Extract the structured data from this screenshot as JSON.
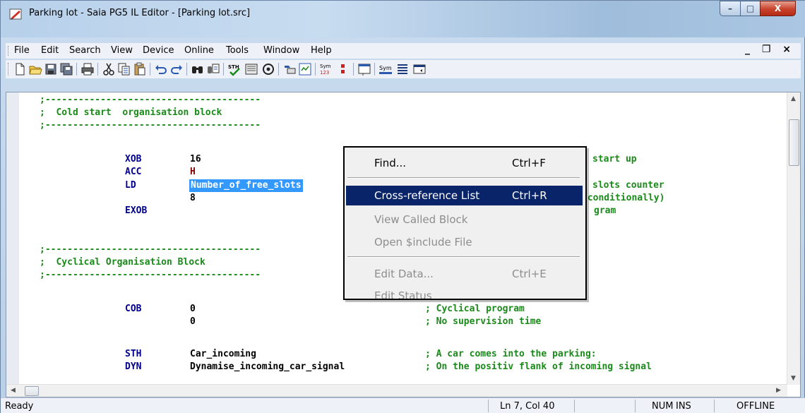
{
  "window": {
    "title": "Parking lot - Saia PG5 IL Editor - [Parking lot.src]",
    "minimize_glyph": "–",
    "maximize_glyph": "□",
    "close_glyph": "X",
    "mdi_controls": "_ ❐ ×"
  },
  "menu": {
    "items": [
      "File",
      "Edit",
      "Search",
      "View",
      "Device",
      "Online",
      "Tools",
      "Window",
      "Help"
    ]
  },
  "toolbar": {
    "icons": [
      "new-file-icon",
      "open-folder-icon",
      "save-icon",
      "save-all-icon",
      "print-icon",
      "cut-icon",
      "copy-icon",
      "paste-icon",
      "undo-icon",
      "redo-icon",
      "find-icon",
      "replace-icon",
      "spell-check-icon",
      "build-icon",
      "online-icon",
      "device-icon",
      "symbol-editor-icon",
      "sym-123-icon",
      "breakpoint-icon",
      "watch-window-icon",
      "sym-icon",
      "list-icon",
      "dock-icon"
    ],
    "sym_label": "Sym",
    "sym123_label": "123",
    "sth_label": "STH"
  },
  "editor": {
    "lines": [
      {
        "c1": ";---------------------------------------",
        "cls": "green"
      },
      {
        "c1": ";  Cold start  organisation block",
        "cls": "green"
      },
      {
        "c1": ";---------------------------------------",
        "cls": "green"
      },
      {
        "c1": "",
        "cls": "green"
      },
      {
        "instr": "XOB",
        "arg": "16",
        "comment": "start up"
      },
      {
        "instr": "ACC",
        "arg": "H",
        "comment": ""
      },
      {
        "instr": "LD",
        "arg": "Number_of_free_slots",
        "comment": "slots counter",
        "selected": true
      },
      {
        "instr": "",
        "arg": "8",
        "comment": "nconditionally)"
      },
      {
        "instr": "EXOB",
        "arg": "",
        "comment": "gram"
      },
      {
        "c1": "",
        "cls": "green"
      },
      {
        "c1": ";---------------------------------------",
        "cls": "green"
      },
      {
        "c1": ";  Cyclical Organisation Block",
        "cls": "green"
      },
      {
        "c1": ";---------------------------------------",
        "cls": "green"
      },
      {
        "c1": "",
        "cls": "green"
      },
      {
        "instr": "COB",
        "arg": "0",
        "comment": "; Cyclical program"
      },
      {
        "instr": "",
        "arg": "0",
        "comment": "; No supervision time"
      },
      {
        "c1": "",
        "cls": "green"
      },
      {
        "instr": "STH",
        "arg": "Car_incoming",
        "comment": "; A car comes into the parking:"
      },
      {
        "instr": "DYN",
        "arg": "Dynamise_incoming_car_signal",
        "comment": "; On the positiv flank of incoming signal"
      }
    ]
  },
  "context_menu": {
    "items": [
      {
        "label": "Find...",
        "shortcut": "Ctrl+F",
        "state": "enabled"
      },
      {
        "label": "Cross-reference List",
        "shortcut": "Ctrl+R",
        "state": "highlighted"
      },
      {
        "label": "View Called Block",
        "shortcut": "",
        "state": "disabled"
      },
      {
        "label": "Open $include File",
        "shortcut": "",
        "state": "disabled"
      },
      {
        "label": "Edit Data...",
        "shortcut": "Ctrl+E",
        "state": "disabled"
      },
      {
        "label": "Edit Status",
        "shortcut": "",
        "state": "disabled"
      }
    ]
  },
  "statusbar": {
    "ready": "Ready",
    "position": "Ln 7, Col 40",
    "num": "NUM",
    "ins": "INS",
    "mode": "OFFLINE"
  },
  "colors": {
    "comment": "#1a8a1a",
    "instruction": "#00008a",
    "selection": "#3399ff",
    "menu_highlight": "#0a246a"
  }
}
